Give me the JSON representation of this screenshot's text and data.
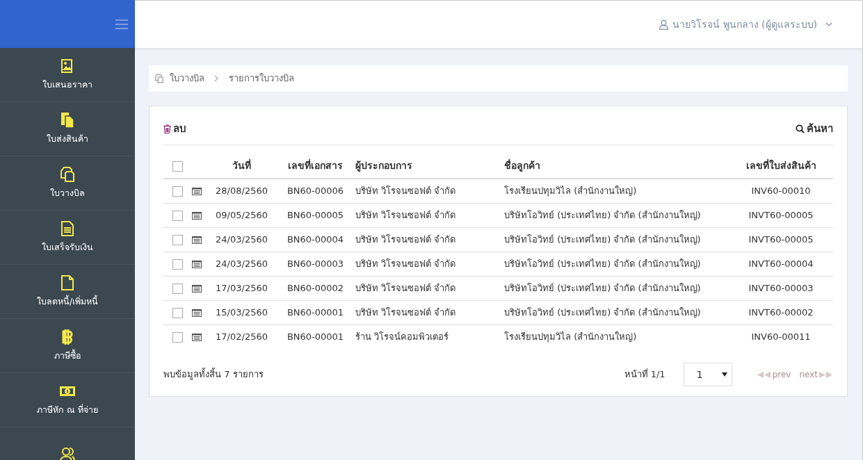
{
  "sidebar": {
    "items": [
      {
        "kind": "image-doc",
        "label": "ใบเสนอราคา",
        "selected": false
      },
      {
        "kind": "docs",
        "label": "ใบส่งสินค้า",
        "selected": false
      },
      {
        "kind": "copy",
        "label": "ใบวางบิล",
        "selected": false
      },
      {
        "kind": "text-doc",
        "label": "ใบเสร็จรับเงิน",
        "selected": false
      },
      {
        "kind": "blank-doc",
        "label": "ใบลดหนี้/เพิ่มหนี้",
        "selected": false
      },
      {
        "kind": "baht",
        "label": "ภาษีซื้อ",
        "selected": false
      },
      {
        "kind": "money",
        "label": "ภาษีหัก ณ ที่จ่าย",
        "selected": false
      },
      {
        "kind": "users"
      }
    ]
  },
  "header": {
    "user": "นายวิโรจน์ พูนกลาง (ผู้ดูแลระบบ)"
  },
  "breadcrumb": [
    "ใบวางบิล",
    "รายการใบวางบิล"
  ],
  "toolbar": {
    "delete": "ลบ",
    "search": "ค้นหา"
  },
  "table": {
    "select_all_checked": false,
    "columns": [
      "วันที่",
      "เลขที่เอกสาร",
      "ผู้ประกอบการ",
      "ชื่อลูกค้า",
      "เลขที่ใบส่งสินค้า"
    ],
    "rows": [
      {
        "checked": false,
        "date": "28/08/2560",
        "doc_no": "BN60-00006",
        "vendor": "บริษัท วิโรจนซอฟต์ จำกัด",
        "customer": "โรงเรียนปทุมวิไล (สำนักงานใหญ่)",
        "delivery_no": "INV60-00010"
      },
      {
        "checked": false,
        "date": "09/05/2560",
        "doc_no": "BN60-00005",
        "vendor": "บริษัท วิโรจนซอฟต์ จำกัด",
        "customer": "บริษัทโอวิทย์ (ประเทศไทย) จำกัด (สำนักงานใหญ่)",
        "delivery_no": "INVT60-00005"
      },
      {
        "checked": false,
        "date": "24/03/2560",
        "doc_no": "BN60-00004",
        "vendor": "บริษัท วิโรจนซอฟต์ จำกัด",
        "customer": "บริษัทโอวิทย์ (ประเทศไทย) จำกัด (สำนักงานใหญ่)",
        "delivery_no": "INVT60-00005"
      },
      {
        "checked": false,
        "date": "24/03/2560",
        "doc_no": "BN60-00003",
        "vendor": "บริษัท วิโรจนซอฟต์ จำกัด",
        "customer": "บริษัทโอวิทย์ (ประเทศไทย) จำกัด (สำนักงานใหญ่)",
        "delivery_no": "INVT60-00004"
      },
      {
        "checked": false,
        "date": "17/03/2560",
        "doc_no": "BN60-00002",
        "vendor": "บริษัท วิโรจนซอฟต์ จำกัด",
        "customer": "บริษัทโอวิทย์ (ประเทศไทย) จำกัด (สำนักงานใหญ่)",
        "delivery_no": "INVT60-00003"
      },
      {
        "checked": false,
        "date": "15/03/2560",
        "doc_no": "BN60-00001",
        "vendor": "บริษัท วิโรจนซอฟต์ จำกัด",
        "customer": "บริษัทโอวิทย์ (ประเทศไทย) จำกัด (สำนักงานใหญ่)",
        "delivery_no": "INVT60-00002"
      },
      {
        "checked": false,
        "date": "17/02/2560",
        "doc_no": "BN60-00001",
        "vendor": "ร้าน วิโรจน์คอมพิวเตอร์",
        "customer": "โรงเรียนปทุมวิไล (สำนักงานใหญ่)",
        "delivery_no": "INV60-00011"
      }
    ]
  },
  "footer": {
    "total": "พบข้อมูลทั้งสิ้น 7 รายการ",
    "page_label": "หน้าที่ 1/1",
    "page_select": "1",
    "prev": {
      "label": "prev",
      "disabled": true
    },
    "next": {
      "label": "next",
      "disabled": true
    }
  }
}
